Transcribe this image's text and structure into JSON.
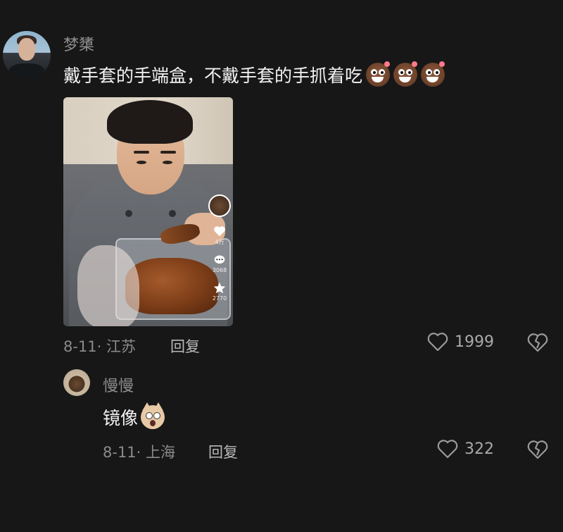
{
  "comment": {
    "username": "梦橥",
    "text": "戴手套的手端盒，不戴手套的手抓着吃",
    "emoji_icons": [
      "laughing-bear-emoji",
      "laughing-bear-emoji",
      "laughing-bear-emoji"
    ],
    "video_sidebar": {
      "like_count": "4万",
      "comment_count": "3068",
      "favorite_count": "2770"
    },
    "date": "8-11",
    "location": "江苏",
    "reply_label": "回复",
    "like_count": "1999"
  },
  "reply": {
    "username": "慢慢",
    "text": "镜像",
    "emoji_icon": "shocked-cat-emoji",
    "date": "8-11",
    "location": "上海",
    "reply_label": "回复",
    "like_count": "322"
  },
  "icons": {
    "like": "heart-outline-icon",
    "dislike": "broken-heart-icon"
  },
  "colors": {
    "background": "#171717",
    "text_primary": "#f2f2f2",
    "text_secondary": "#8a8a8a"
  }
}
